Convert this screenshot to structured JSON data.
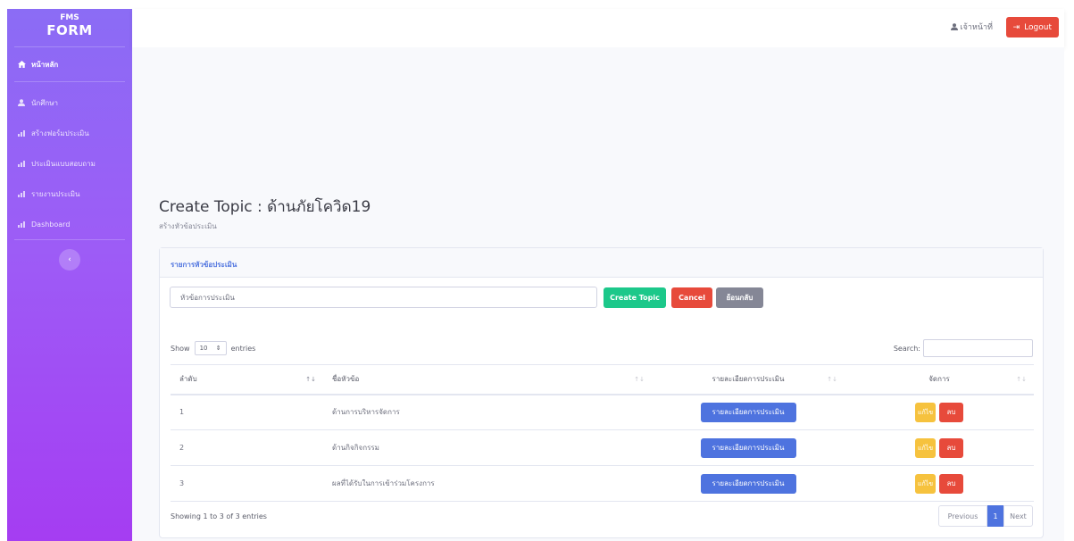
{
  "sidebar": {
    "brand_top": "FMS",
    "brand_main": "FORM",
    "home": "หน้าหลัก",
    "items": [
      {
        "label": "นักศึกษา"
      },
      {
        "label": "สร้างฟอร์มประเมิน"
      },
      {
        "label": "ประเมินแบบสอบถาม"
      },
      {
        "label": "รายงานประเมิน"
      },
      {
        "label": "Dashboard"
      }
    ],
    "collapse_glyph": "‹"
  },
  "topbar": {
    "user": "เจ้าหน้าที่",
    "logout": "Logout"
  },
  "page": {
    "title": "Create Topic : ด้านภัยโควิด19",
    "subtitle": "สร้างหัวข้อประเมิน"
  },
  "card": {
    "header": "รายการหัวข้อประเมิน",
    "input_placeholder": "หัวข้อการประเมิน",
    "btn_create": "Create Topic",
    "btn_cancel": "Cancel",
    "btn_back": "ย้อนกลับ"
  },
  "datatable": {
    "show_label": "Show",
    "entries_value": "10",
    "entries_label": "entries",
    "search_label": "Search:",
    "columns": [
      "ลำดับ",
      "ชื่อหัวข้อ",
      "รายละเอียดการประเมิน",
      "จัดการ"
    ],
    "rows": [
      {
        "no": "1",
        "name": "ด้านการบริหารจัดการ",
        "detail": "รายละเอียดการประเมิน",
        "edit": "แก้ไข",
        "del": "ลบ"
      },
      {
        "no": "2",
        "name": "ด้านกิจกิจกรรม",
        "detail": "รายละเอียดการประเมิน",
        "edit": "แก้ไข",
        "del": "ลบ"
      },
      {
        "no": "3",
        "name": "ผลที่ได้รับในการเข้าร่วมโครงการ",
        "detail": "รายละเอียดการประเมิน",
        "edit": "แก้ไข",
        "del": "ลบ"
      }
    ],
    "info": "Showing 1 to 3 of 3 entries",
    "prev": "Previous",
    "page": "1",
    "next": "Next"
  },
  "colors": {
    "sidebar_top": "#8b6cf5",
    "sidebar_bottom": "#a53df2",
    "primary": "#4e73df",
    "success": "#1cc88a",
    "danger": "#e74a3b",
    "warning": "#f6c23e",
    "secondary": "#858796"
  }
}
